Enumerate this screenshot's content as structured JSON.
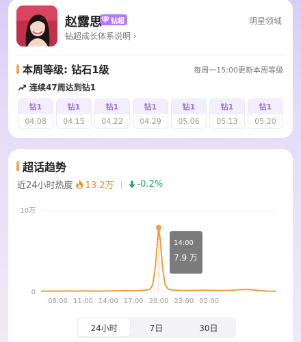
{
  "profile": {
    "name": "赵露思",
    "badge_label": "钻超",
    "growth_link": "钻超成长体系说明",
    "category": "明星领域"
  },
  "level": {
    "title": "本周等级: 钻石1级",
    "update_note": "每周一15:00更新本周等级",
    "streak_text": "连续47周达到钻1",
    "weeks": [
      {
        "level": "钻1",
        "date": "04.08"
      },
      {
        "level": "钻1",
        "date": "04.15"
      },
      {
        "level": "钻1",
        "date": "04.22"
      },
      {
        "level": "钻1",
        "date": "04.29"
      },
      {
        "level": "钻1",
        "date": "05.06"
      },
      {
        "level": "钻1",
        "date": "05.13"
      },
      {
        "level": "钻1",
        "date": "05.20"
      }
    ]
  },
  "trend": {
    "title": "超话趋势",
    "heat_label": "近24小时热度",
    "heat_value": "13.2万",
    "change": "-0.2%",
    "tooltip": {
      "time": "14:00",
      "value": "7.9 万"
    },
    "tabs": [
      "24小时",
      "7日",
      "30日"
    ],
    "active_tab": "24小时"
  },
  "colors": {
    "accent": "#f29b3a",
    "badge": "#b27af0",
    "level_text": "#9a6fd9",
    "increase": "#f08a1d",
    "decrease": "#2aa55d"
  },
  "chart_data": {
    "type": "line",
    "ytick_labels": [
      "10万",
      "0"
    ],
    "xtick_labels": [
      "08:00",
      "11:00",
      "14:00",
      "17:00",
      "20:00",
      "23:00",
      "02:00"
    ],
    "ylim": [
      0,
      100000
    ],
    "series": [
      {
        "values": [
          [
            0,
            200
          ],
          [
            1,
            400
          ],
          [
            2,
            300
          ],
          [
            3,
            500
          ],
          [
            4,
            300
          ],
          [
            5,
            600
          ],
          [
            6,
            400
          ],
          [
            7,
            300
          ],
          [
            8,
            500
          ],
          [
            9,
            700
          ],
          [
            10,
            900
          ],
          [
            11,
            800
          ],
          [
            12,
            1200
          ],
          [
            12.5,
            1500
          ],
          [
            13.0,
            3000
          ],
          [
            13.3,
            9000
          ],
          [
            13.6,
            30000
          ],
          [
            13.85,
            62000
          ],
          [
            14,
            79000
          ],
          [
            14.2,
            62000
          ],
          [
            14.45,
            30000
          ],
          [
            14.75,
            9000
          ],
          [
            15.1,
            3000
          ],
          [
            15.6,
            1700
          ],
          [
            16.5,
            1300
          ],
          [
            18,
            1200
          ],
          [
            19.5,
            1400
          ],
          [
            21,
            1200
          ],
          [
            22.5,
            1300
          ],
          [
            23.5,
            2000
          ],
          [
            24.5,
            2500
          ],
          [
            25.5,
            1600
          ],
          [
            26.5,
            600
          ],
          [
            27,
            300
          ],
          [
            28,
            200
          ]
        ]
      }
    ],
    "highlight": {
      "x": "14:00",
      "y": 79000
    },
    "grid": false
  }
}
